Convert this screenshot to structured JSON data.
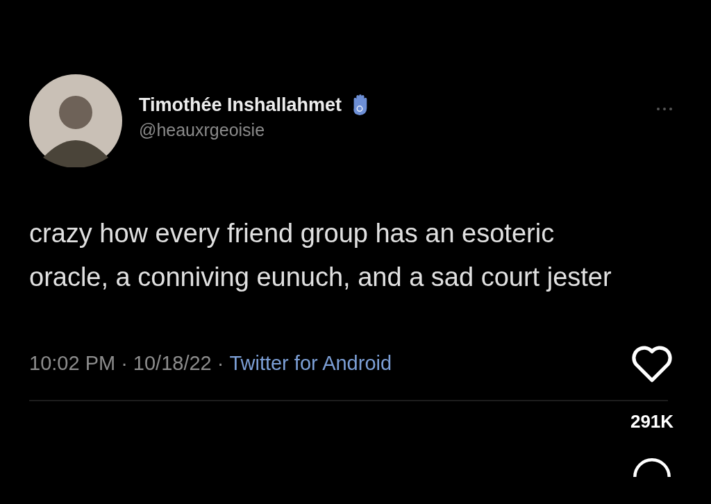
{
  "tweet": {
    "author": {
      "name": "Timothée Inshallahmet",
      "handle": "@heauxrgeoisie"
    },
    "text": "crazy how every friend group has an esoteric oracle, a conniving eunuch, and a sad court jester",
    "meta": [
      {
        "kind": "plain",
        "text": "10:02 PM"
      },
      {
        "kind": "separator",
        "text": "·"
      },
      {
        "kind": "plain",
        "text": "10/18/22"
      },
      {
        "kind": "separator",
        "text": "·"
      },
      {
        "kind": "link",
        "text": "Twitter for Android"
      }
    ]
  },
  "side_rail": {
    "like_count": "291K"
  }
}
